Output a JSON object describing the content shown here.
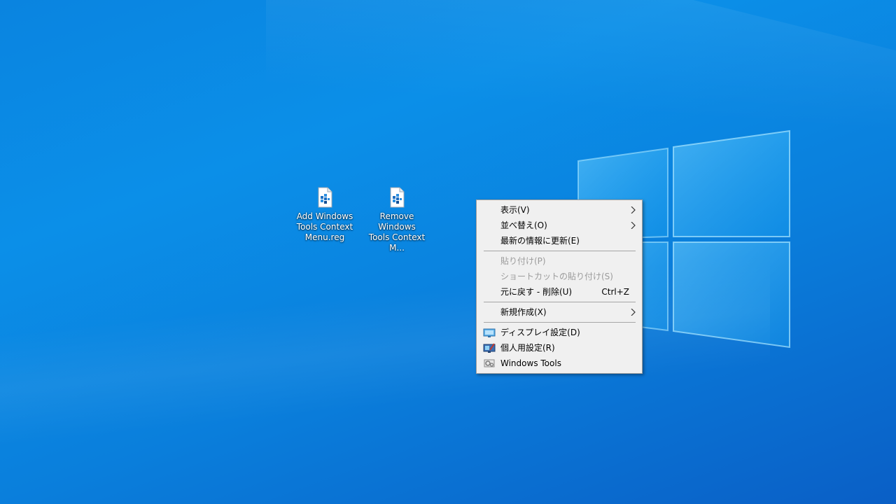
{
  "desktop": {
    "icons": [
      {
        "name": "Add Windows Tools Context Menu.reg",
        "label": "Add Windows\nTools Context\nMenu.reg",
        "icon": "registry-file-icon"
      },
      {
        "name": "Remove Windows Tools Context Menu.reg",
        "label": "Remove Windows\nTools Context M...",
        "icon": "registry-file-icon"
      }
    ]
  },
  "context_menu": {
    "items": [
      {
        "label": "表示(V)",
        "submenu": true,
        "enabled": true
      },
      {
        "label": "並べ替え(O)",
        "submenu": true,
        "enabled": true
      },
      {
        "label": "最新の情報に更新(E)",
        "enabled": true
      },
      {
        "label": "貼り付け(P)",
        "enabled": false
      },
      {
        "label": "ショートカットの貼り付け(S)",
        "enabled": false
      },
      {
        "label": "元に戻す - 削除(U)",
        "shortcut": "Ctrl+Z",
        "enabled": true
      },
      {
        "label": "新規作成(X)",
        "submenu": true,
        "enabled": true
      },
      {
        "label": "ディスプレイ設定(D)",
        "icon": "display-settings-icon",
        "enabled": true
      },
      {
        "label": "個人用設定(R)",
        "icon": "personalize-icon",
        "enabled": true
      },
      {
        "label": "Windows Tools",
        "icon": "windows-tools-icon",
        "enabled": true
      }
    ]
  },
  "colors": {
    "desktop_blue": "#0a84e0",
    "menu_background": "#f0f0f0",
    "disabled_text": "#9b9b9b"
  }
}
